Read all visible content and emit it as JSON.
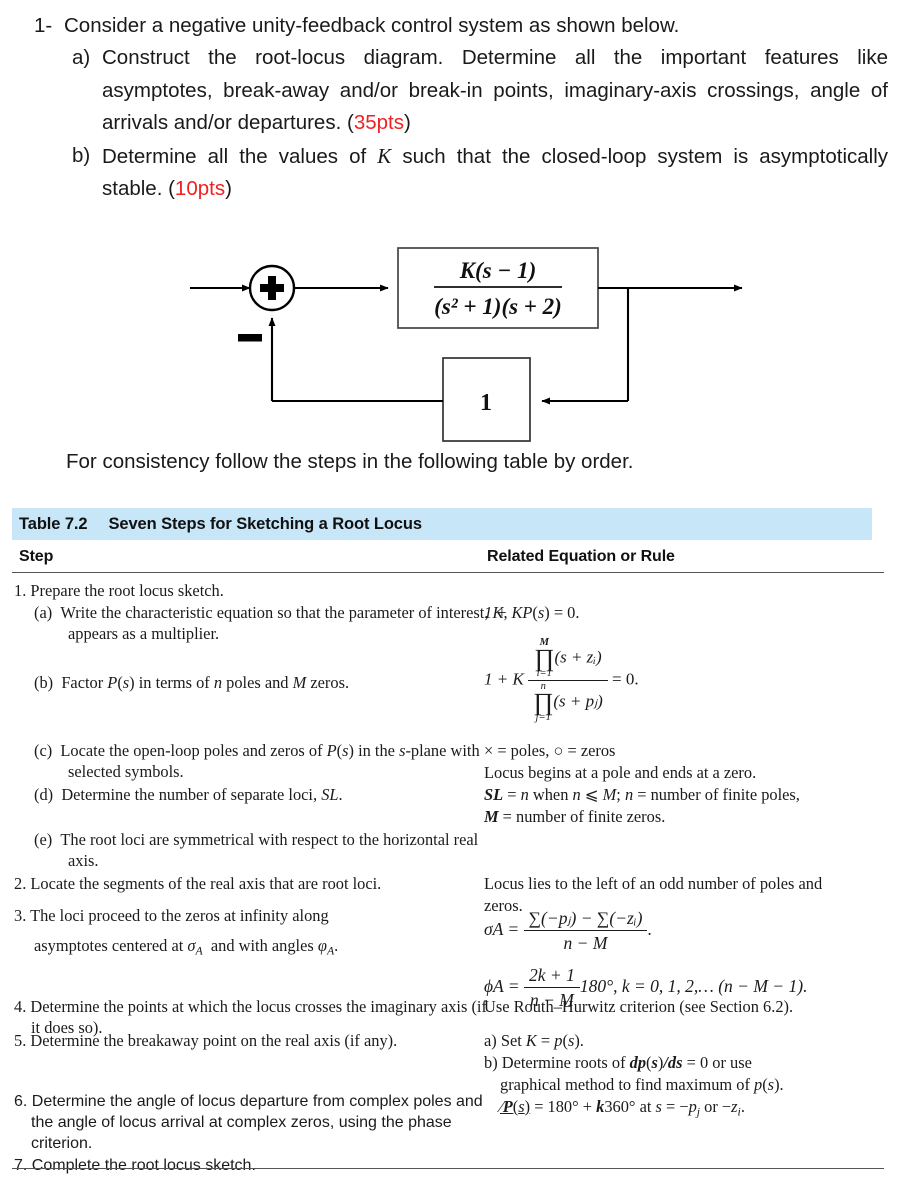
{
  "question": {
    "item1_marker": "1-",
    "item1_text": "Consider a negative unity-feedback control system as shown below.",
    "item_a_marker": "a)",
    "item_a_text_1": "Construct the root-locus diagram. Determine all the important features like asymptotes, break-away and/or break-in points, imaginary-axis crossings, angle of arrivals and/or departures. (",
    "item_a_points": "35pts",
    "item_a_text_2": ")",
    "item_b_marker": "b)",
    "item_b_text_1": "Determine all the values of ",
    "item_b_var": "K",
    "item_b_text_2": " such that the closed-loop system is asymptotically stable. (",
    "item_b_points": "10pts",
    "item_b_text_3": ")"
  },
  "block_diagram": {
    "summing_junction_sign_plus": "+",
    "summing_junction_sign_minus": "−",
    "plant_numerator": "K(s − 1)",
    "plant_denominator": "(s² + 1)(s + 2)",
    "feedback_gain": "1"
  },
  "consistency_note": "For consistency follow the steps in the following table by order.",
  "table": {
    "title_number": "Table 7.2",
    "title_text": "Seven Steps for Sketching a Root Locus",
    "header_band_color": "#c7e6f8",
    "columns": [
      "Step",
      "Related Equation or Rule"
    ],
    "steps": {
      "s1": "1. Prepare the root locus sketch.",
      "s1a_marker": "(a)",
      "s1a_text": "Write the characteristic equation so that the parameter of interest, K, appears as a multiplier.",
      "s1b_marker": "(b)",
      "s1b_text": "Factor P(s) in terms of n poles and M zeros.",
      "s1c_marker": "(c)",
      "s1c_text": "Locate the open-loop poles and zeros of P(s) in the s-plane with selected symbols.",
      "s1d_marker": "(d)",
      "s1d_text": "Determine the number of separate loci, SL.",
      "s1e_marker": "(e)",
      "s1e_text": "The root loci are symmetrical with respect to the horizontal real axis.",
      "s2": "2. Locate the segments of the real axis that are root loci.",
      "s3_line1": "3. The loci proceed to the zeros at infinity along",
      "s3_line2": "asymptotes centered at σA and with angles ϕA.",
      "s4": "4. Determine the points at which the locus crosses the imaginary axis (if it does so).",
      "s5": "5. Determine the breakaway point on the real axis (if any).",
      "s6": "6. Determine the angle of locus departure from complex poles and the angle of locus arrival at complex zeros, using the phase criterion.",
      "s7": "7. Complete the root locus sketch."
    },
    "rules": {
      "r1a": "1 + KP(s) = 0.",
      "r1b_prefix": "1 + K",
      "r1b_num_limit_top": "M",
      "r1b_num_limit_bottom": "i=1",
      "r1b_num_body": "(s + zᵢ)",
      "r1b_den_limit_top": "n",
      "r1b_den_limit_bottom": "j=1",
      "r1b_den_body": "(s + pⱼ)",
      "r1b_suffix": "= 0.",
      "r1c_line1": "× = poles, ○ = zeros",
      "r1c_line2": "Locus begins at a pole and ends at a zero.",
      "r1d_line1": "SL = n when n ⩾ M; n = number of finite poles,",
      "r1d_line2": "M = number of finite zeros.",
      "r2_line1": "Locus lies to the left of an odd number of poles and",
      "r2_line2": "zeros.",
      "r3_sigma_lhs": "σA =",
      "r3_sigma_num": "∑(−pⱼ) − ∑(−zᵢ)",
      "r3_sigma_den": "n − M",
      "r3_phi_lhs": "ϕA =",
      "r3_phi_num": "2k + 1",
      "r3_phi_den": "n − M",
      "r3_phi_rest": "180°, k = 0, 1, 2,… (n − M − 1).",
      "r4": "Use Routh–Hurwitz criterion (see Section 6.2).",
      "r5a": "a) Set K = p(s).",
      "r5b_line1": "b) Determine roots of dp(s)/ds = 0 or use",
      "r5b_line2": "graphical method to find maximum of p(s).",
      "r6": "∠P(s) = 180° + k360° at s = −pⱼ or −zᵢ."
    }
  }
}
